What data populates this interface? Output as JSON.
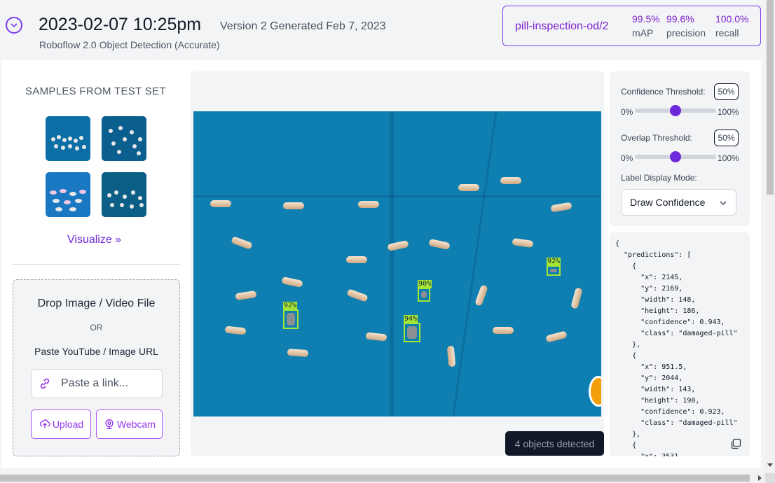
{
  "header": {
    "title": "2023-02-07 10:25pm",
    "version": "Version 2 Generated Feb 7, 2023",
    "subtitle": "Roboflow 2.0 Object Detection (Accurate)"
  },
  "metrics": {
    "model_id": "pill-inspection-od/2",
    "items": [
      {
        "value": "99.5%",
        "label": "mAP"
      },
      {
        "value": "99.6%",
        "label": "precision"
      },
      {
        "value": "100.0%",
        "label": "recall"
      }
    ]
  },
  "samples": {
    "title": "SAMPLES FROM TEST SET",
    "visualize_label": "Visualize »"
  },
  "upload": {
    "drop_title": "Drop Image / Video File",
    "or_text": "OR",
    "paste_title": "Paste YouTube / Image URL",
    "link_placeholder": "Paste a link...",
    "upload_label": "Upload",
    "webcam_label": "Webcam"
  },
  "detections": [
    {
      "label": "92%"
    },
    {
      "label": "94%"
    },
    {
      "label": "90%"
    },
    {
      "label": "92%"
    }
  ],
  "objects_detected": "4 objects detected",
  "controls": {
    "confidence_label": "Confidence Threshold:",
    "confidence_value": "50%",
    "confidence_fraction": 0.5,
    "overlap_label": "Overlap Threshold:",
    "overlap_value": "50%",
    "overlap_fraction": 0.5,
    "slider_min": "0%",
    "slider_max": "100%",
    "label_mode_label": "Label Display Mode:",
    "label_mode_value": "Draw Confidence"
  },
  "json_output": "{\n  \"predictions\": [\n    {\n      \"x\": 2145,\n      \"y\": 2169,\n      \"width\": 148,\n      \"height\": 186,\n      \"confidence\": 0.943,\n      \"class\": \"damaged-pill\"\n    },\n    {\n      \"x\": 951.5,\n      \"y\": 2044,\n      \"width\": 143,\n      \"height\": 190,\n      \"confidence\": 0.923,\n      \"class\": \"damaged-pill\"\n    },\n    {\n      \"x\": 3531,",
  "colors": {
    "accent": "#7c3aed",
    "bbox": "#a3e635",
    "image_bg": "#0e7fb0"
  }
}
